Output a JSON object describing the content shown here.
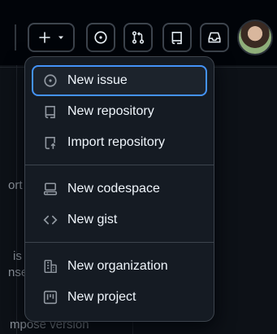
{
  "background": {
    "left_fragments": [
      "ort",
      "is",
      "nse"
    ],
    "bottom_text": "mpose version"
  },
  "menu": {
    "groups": [
      [
        {
          "label": "New issue",
          "icon": "issue-opened-icon",
          "focused": true
        },
        {
          "label": "New repository",
          "icon": "repo-icon"
        },
        {
          "label": "Import repository",
          "icon": "repo-push-icon"
        }
      ],
      [
        {
          "label": "New codespace",
          "icon": "codespaces-icon"
        },
        {
          "label": "New gist",
          "icon": "code-icon"
        }
      ],
      [
        {
          "label": "New organization",
          "icon": "organization-icon"
        },
        {
          "label": "New project",
          "icon": "project-icon"
        }
      ]
    ]
  },
  "colors": {
    "background": "#010409",
    "menu_bg": "#151b23",
    "focus_ring": "#4493f8",
    "text": "#f0f6fc",
    "muted": "#9198a1"
  }
}
